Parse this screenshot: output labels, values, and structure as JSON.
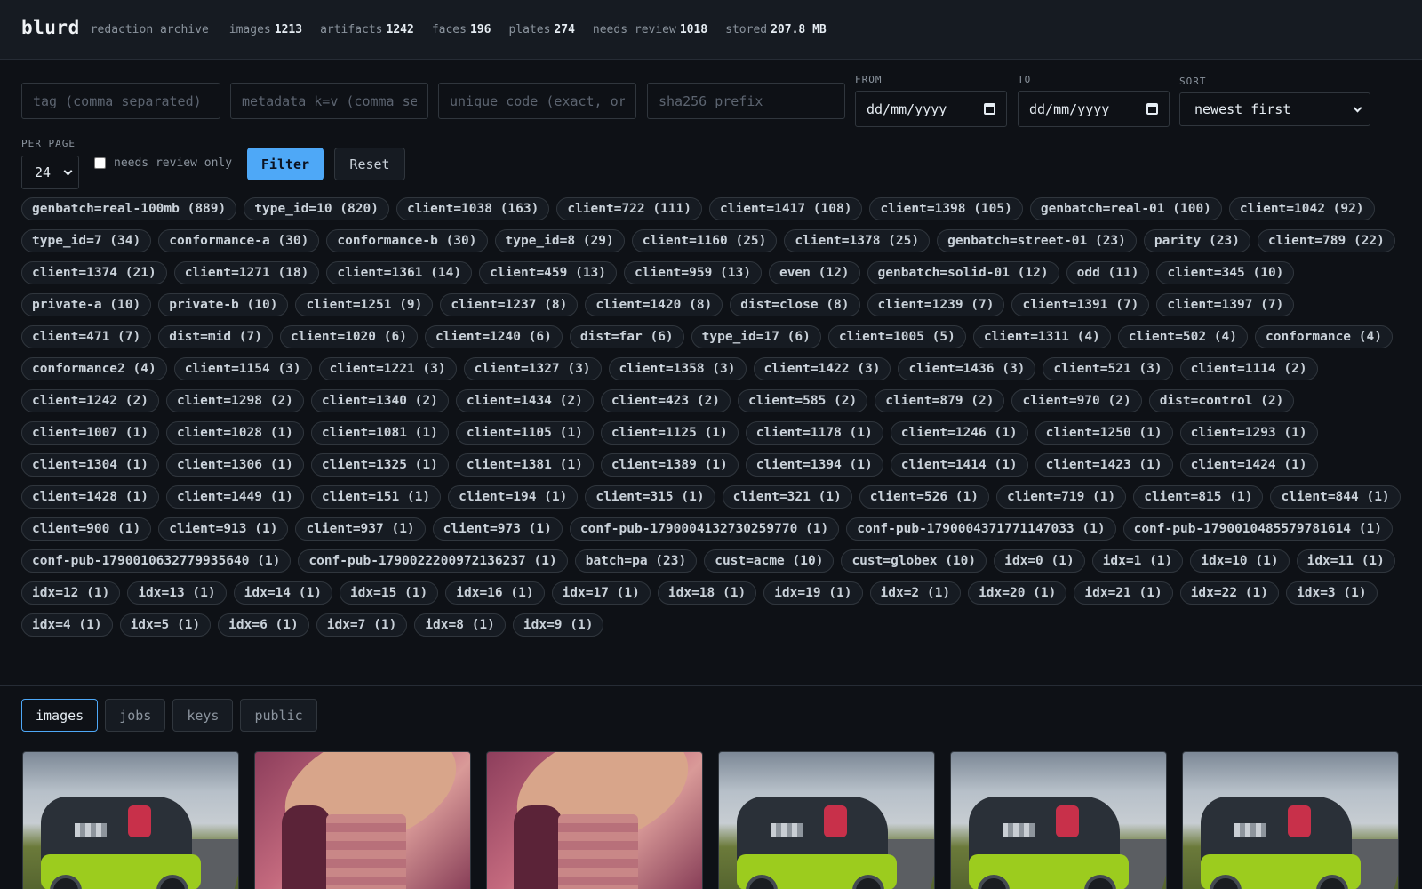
{
  "header": {
    "brand": "blurd",
    "subtitle": "redaction archive",
    "stats": [
      {
        "label": "images",
        "value": "1213"
      },
      {
        "label": "artifacts",
        "value": "1242"
      },
      {
        "label": "faces",
        "value": "196"
      },
      {
        "label": "plates",
        "value": "274"
      },
      {
        "label": "needs review",
        "value": "1018"
      },
      {
        "label": "stored",
        "value": "207.8 MB"
      }
    ]
  },
  "filters": {
    "tag_placeholder": "tag (comma separated)",
    "metadata_placeholder": "metadata k=v (comma separated)",
    "unique_code_placeholder": "unique code (exact, or prefix)",
    "sha_placeholder": "sha256 prefix",
    "from_label": "FROM",
    "from_value": "dd/mm/yyyy",
    "to_label": "TO",
    "to_value": "dd/mm/yyyy",
    "sort_label": "SORT",
    "sort_value": "newest first",
    "per_page_label": "PER PAGE",
    "per_page_value": "24",
    "needs_review_label": "needs review only",
    "filter_button": "Filter",
    "reset_button": "Reset"
  },
  "tags": [
    "genbatch=real-100mb (889)",
    "type_id=10 (820)",
    "client=1038 (163)",
    "client=722 (111)",
    "client=1417 (108)",
    "client=1398 (105)",
    "genbatch=real-01 (100)",
    "client=1042 (92)",
    "type_id=7 (34)",
    "conformance-a (30)",
    "conformance-b (30)",
    "type_id=8 (29)",
    "client=1160 (25)",
    "client=1378 (25)",
    "genbatch=street-01 (23)",
    "parity (23)",
    "client=789 (22)",
    "client=1374 (21)",
    "client=1271 (18)",
    "client=1361 (14)",
    "client=459 (13)",
    "client=959 (13)",
    "even (12)",
    "genbatch=solid-01 (12)",
    "odd (11)",
    "client=345 (10)",
    "private-a (10)",
    "private-b (10)",
    "client=1251 (9)",
    "client=1237 (8)",
    "client=1420 (8)",
    "dist=close (8)",
    "client=1239 (7)",
    "client=1391 (7)",
    "client=1397 (7)",
    "client=471 (7)",
    "dist=mid (7)",
    "client=1020 (6)",
    "client=1240 (6)",
    "dist=far (6)",
    "type_id=17 (6)",
    "client=1005 (5)",
    "client=1311 (4)",
    "client=502 (4)",
    "conformance (4)",
    "conformance2 (4)",
    "client=1154 (3)",
    "client=1221 (3)",
    "client=1327 (3)",
    "client=1358 (3)",
    "client=1422 (3)",
    "client=1436 (3)",
    "client=521 (3)",
    "client=1114 (2)",
    "client=1242 (2)",
    "client=1298 (2)",
    "client=1340 (2)",
    "client=1434 (2)",
    "client=423 (2)",
    "client=585 (2)",
    "client=879 (2)",
    "client=970 (2)",
    "dist=control (2)",
    "client=1007 (1)",
    "client=1028 (1)",
    "client=1081 (1)",
    "client=1105 (1)",
    "client=1125 (1)",
    "client=1178 (1)",
    "client=1246 (1)",
    "client=1250 (1)",
    "client=1293 (1)",
    "client=1304 (1)",
    "client=1306 (1)",
    "client=1325 (1)",
    "client=1381 (1)",
    "client=1389 (1)",
    "client=1394 (1)",
    "client=1414 (1)",
    "client=1423 (1)",
    "client=1424 (1)",
    "client=1428 (1)",
    "client=1449 (1)",
    "client=151 (1)",
    "client=194 (1)",
    "client=315 (1)",
    "client=321 (1)",
    "client=526 (1)",
    "client=719 (1)",
    "client=815 (1)",
    "client=844 (1)",
    "client=900 (1)",
    "client=913 (1)",
    "client=937 (1)",
    "client=973 (1)",
    "conf-pub-1790004132730259770 (1)",
    "conf-pub-1790004371771147033 (1)",
    "conf-pub-1790010485579781614 (1)",
    "conf-pub-1790010632779935640 (1)",
    "conf-pub-1790022200972136237 (1)",
    "batch=pa (23)",
    "cust=acme (10)",
    "cust=globex (10)",
    "idx=0 (1)",
    "idx=1 (1)",
    "idx=10 (1)",
    "idx=11 (1)",
    "idx=12 (1)",
    "idx=13 (1)",
    "idx=14 (1)",
    "idx=15 (1)",
    "idx=16 (1)",
    "idx=17 (1)",
    "idx=18 (1)",
    "idx=19 (1)",
    "idx=2 (1)",
    "idx=20 (1)",
    "idx=21 (1)",
    "idx=22 (1)",
    "idx=3 (1)",
    "idx=4 (1)",
    "idx=5 (1)",
    "idx=6 (1)",
    "idx=7 (1)",
    "idx=8 (1)",
    "idx=9 (1)"
  ],
  "tabs": [
    "images",
    "jobs",
    "keys",
    "public"
  ],
  "active_tab": "images",
  "thumbnails": [
    "car",
    "lena",
    "lena",
    "car",
    "car",
    "car"
  ]
}
